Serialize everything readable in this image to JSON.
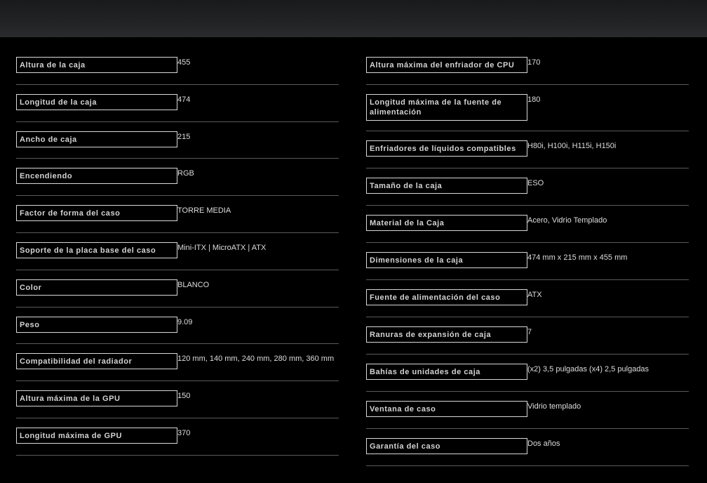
{
  "left_specs": [
    {
      "label": "Altura de la caja",
      "value": "455"
    },
    {
      "label": "Longitud de la caja",
      "value": "474"
    },
    {
      "label": "Ancho de caja",
      "value": "215"
    },
    {
      "label": "Encendiendo",
      "value": "RGB"
    },
    {
      "label": "Factor de forma del caso",
      "value": "TORRE MEDIA"
    },
    {
      "label": "Soporte de la placa base del caso",
      "value": "Mini-ITX | MicroATX | ATX"
    },
    {
      "label": "Color",
      "value": "BLANCO"
    },
    {
      "label": "Peso",
      "value": "9.09"
    },
    {
      "label": "Compatibilidad del radiador",
      "value": "120 mm, 140 mm, 240 mm, 280 mm, 360 mm"
    },
    {
      "label": "Altura máxima de la GPU",
      "value": "150"
    },
    {
      "label": "Longitud máxima de GPU",
      "value": "370"
    }
  ],
  "right_specs": [
    {
      "label": "Altura máxima del enfriador de CPU",
      "value": "170"
    },
    {
      "label": "Longitud máxima de la fuente de alimentación",
      "value": "180"
    },
    {
      "label": "Enfriadores de líquidos compatibles",
      "value": "H80i, H100i, H115i, H150i"
    },
    {
      "label": "Tamaño de la caja",
      "value": "ESO"
    },
    {
      "label": "Material de la Caja",
      "value": "Acero, Vidrio Templado"
    },
    {
      "label": "Dimensiones de la caja",
      "value": "474 mm x 215 mm x 455 mm"
    },
    {
      "label": "Fuente de alimentación del caso",
      "value": "ATX"
    },
    {
      "label": "Ranuras de expansión de caja",
      "value": "7"
    },
    {
      "label": "Bahías de unidades de caja",
      "value": "(x2) 3,5 pulgadas (x4) 2,5 pulgadas"
    },
    {
      "label": "Ventana de caso",
      "value": "Vidrio templado"
    },
    {
      "label": "Garantía del caso",
      "value": "Dos años"
    }
  ]
}
